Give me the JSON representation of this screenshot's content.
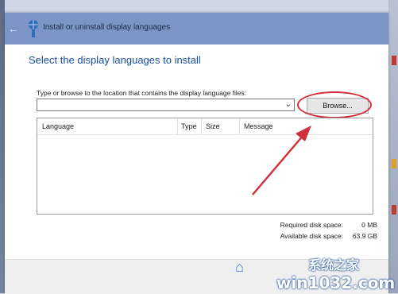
{
  "window": {
    "title": "Install or uninstall display languages",
    "back_icon": "back-arrow-icon"
  },
  "heading": "Select the display languages to install",
  "instruction": "Type or browse to the location that contains the display language files:",
  "path_input": {
    "value": "",
    "placeholder": ""
  },
  "browse_label": "Browse...",
  "table": {
    "columns": [
      "Language",
      "Type",
      "Size",
      "Message"
    ],
    "rows": []
  },
  "disk": {
    "required_label": "Required disk space:",
    "required_value": "0 MB",
    "available_label": "Available disk space:",
    "available_value": "63.9 GB"
  },
  "watermark": {
    "site": "win1032.com",
    "chinese": "系统之家"
  },
  "colors": {
    "titlebar": "#7c95c6",
    "heading": "#1b4fa0",
    "annotation_red": "#d0303b"
  }
}
